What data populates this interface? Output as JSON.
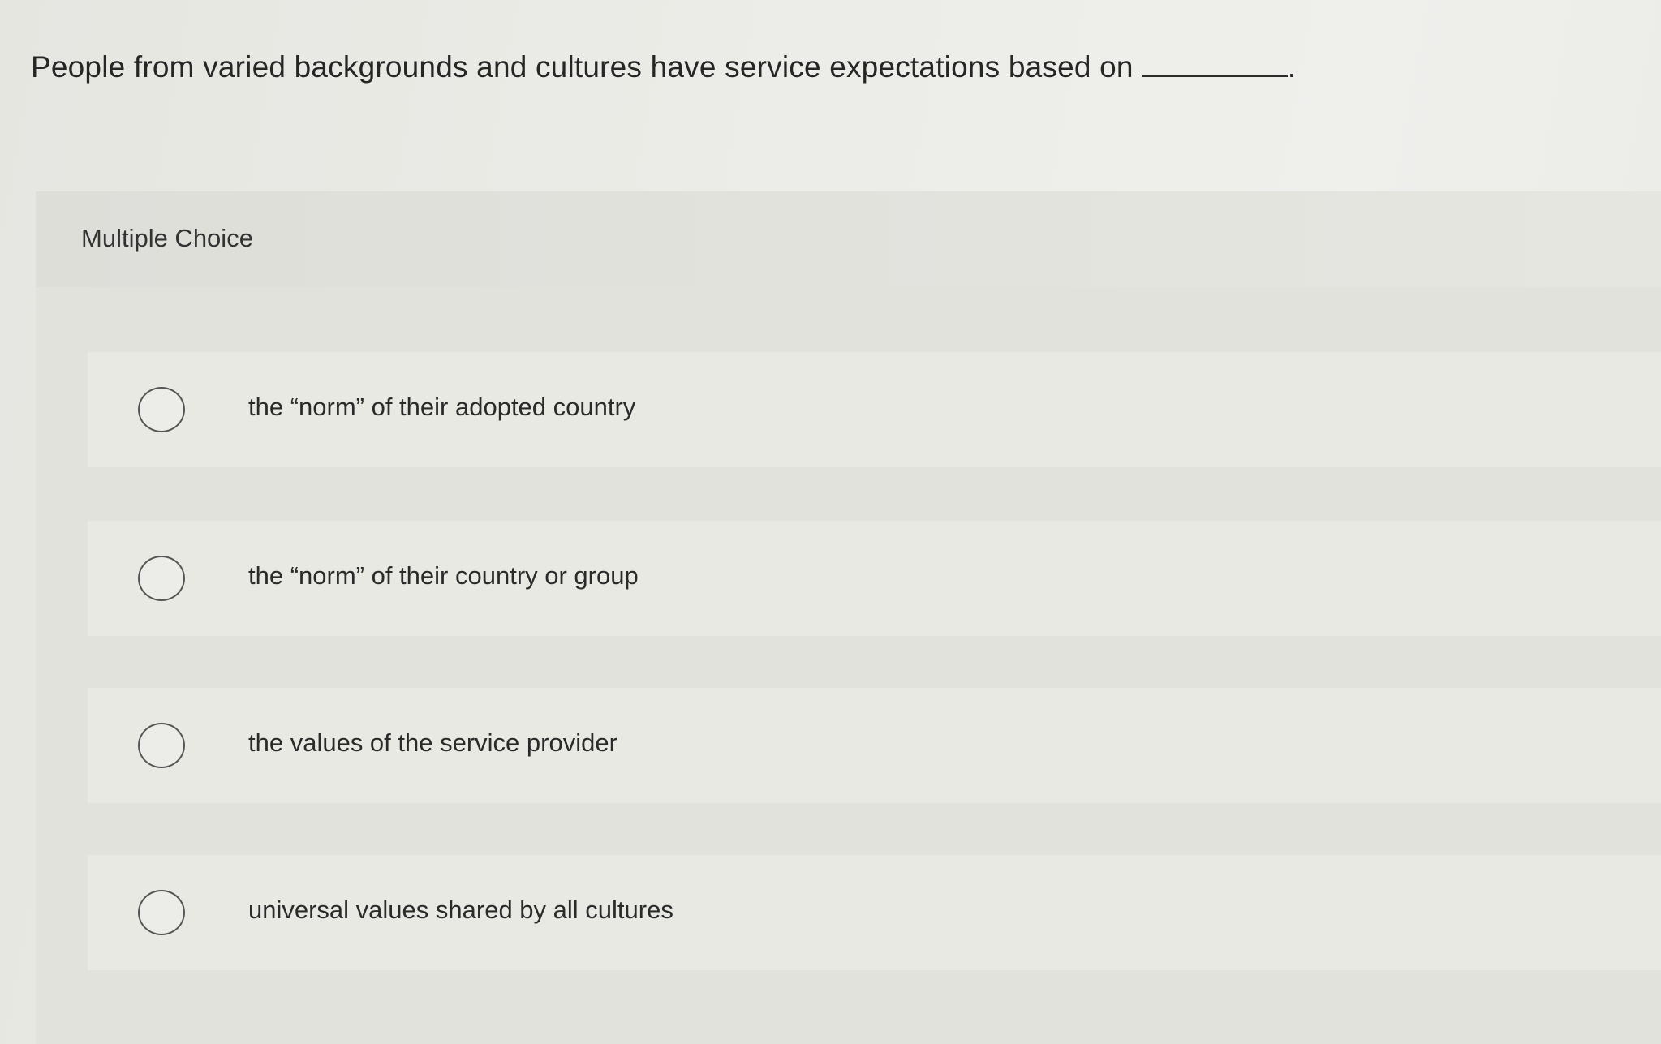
{
  "question": {
    "text": "People from varied backgrounds and cultures have service expectations based on",
    "trailing": "."
  },
  "section_label": "Multiple Choice",
  "options": [
    {
      "label": "the “norm” of their adopted country"
    },
    {
      "label": "the “norm” of their country or group"
    },
    {
      "label": "the values of the service provider"
    },
    {
      "label": "universal values shared by all cultures"
    }
  ],
  "colors": {
    "background": "#ecece8",
    "panel": "#e2e2dd",
    "option": "#e9e9e4",
    "text": "#262626"
  }
}
